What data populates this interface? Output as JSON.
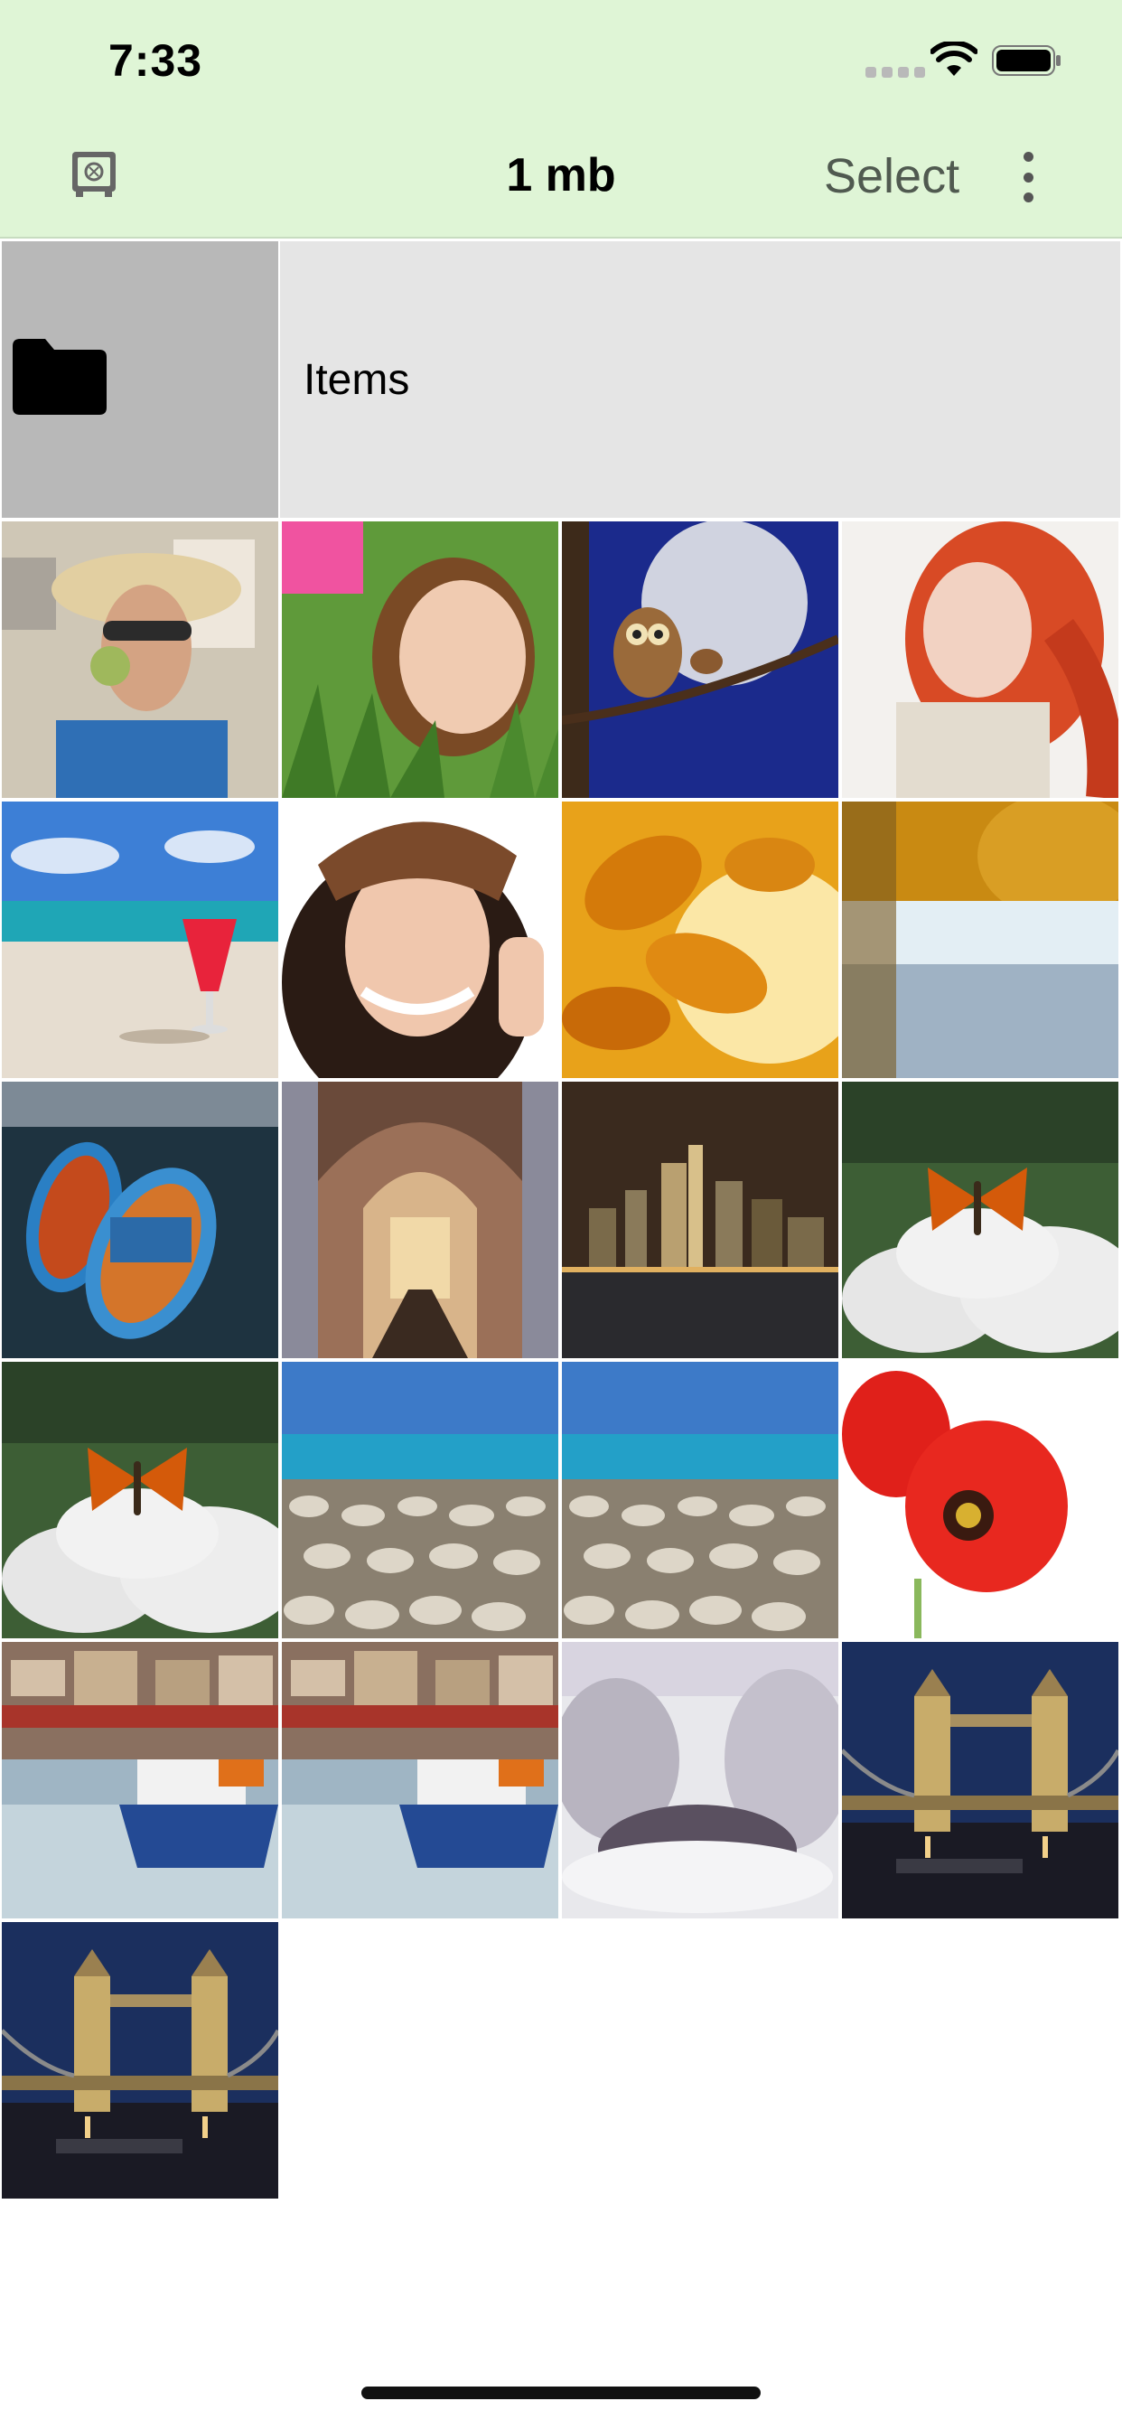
{
  "status_bar": {
    "time": "7:33"
  },
  "nav": {
    "title": "1 mb",
    "select_label": "Select",
    "vault_icon": "vault-icon",
    "more_icon": "more-vertical-icon"
  },
  "folder": {
    "name": "Items",
    "icon": "folder-icon"
  },
  "photos": [
    "woman-sun-hat",
    "woman-lying-grass",
    "owl-moon-night",
    "red-haired-woman",
    "cocktail-beach",
    "woman-brown-hat",
    "autumn-leaves",
    "autumn-lake",
    "blue-boats",
    "cathedral-interior",
    "city-skyline-night",
    "butterfly-flowers",
    "butterfly-flowers",
    "pebble-beach",
    "pebble-beach",
    "red-tulips",
    "harbor-boat",
    "harbor-boat",
    "snowy-trees",
    "tower-bridge-night",
    "tower-bridge-night"
  ],
  "colors": {
    "header_bg": "#dff5d6",
    "folder_thumb_bg": "#b8b8b8",
    "folder_row_bg": "#e5e5e5"
  }
}
